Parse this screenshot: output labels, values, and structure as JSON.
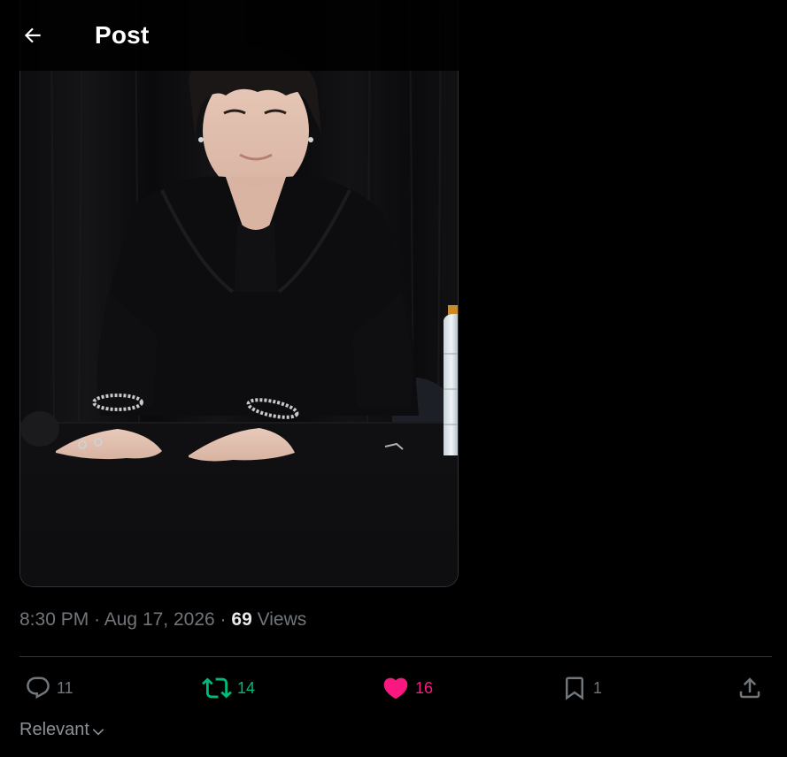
{
  "header": {
    "title": "Post"
  },
  "tweet": {
    "time": "8:30 PM",
    "date": "Aug 17, 2026",
    "views_count": "69",
    "views_label": "Views",
    "separator": "·"
  },
  "actions": {
    "replies": "11",
    "retweets": "14",
    "likes": "16",
    "bookmarks": "1"
  },
  "sort": {
    "label": "Relevant"
  },
  "colors": {
    "background": "#000000",
    "retweet": "#00ba7c",
    "like": "#f91880",
    "muted": "#71767b",
    "divider": "#2f3336"
  },
  "icons": {
    "back": "arrow-left-icon",
    "reply": "speech-bubble-icon",
    "retweet": "retweet-arrows-icon",
    "like": "heart-icon",
    "bookmark": "bookmark-icon",
    "share": "share-upload-icon",
    "sort": "chevron-down-icon"
  }
}
